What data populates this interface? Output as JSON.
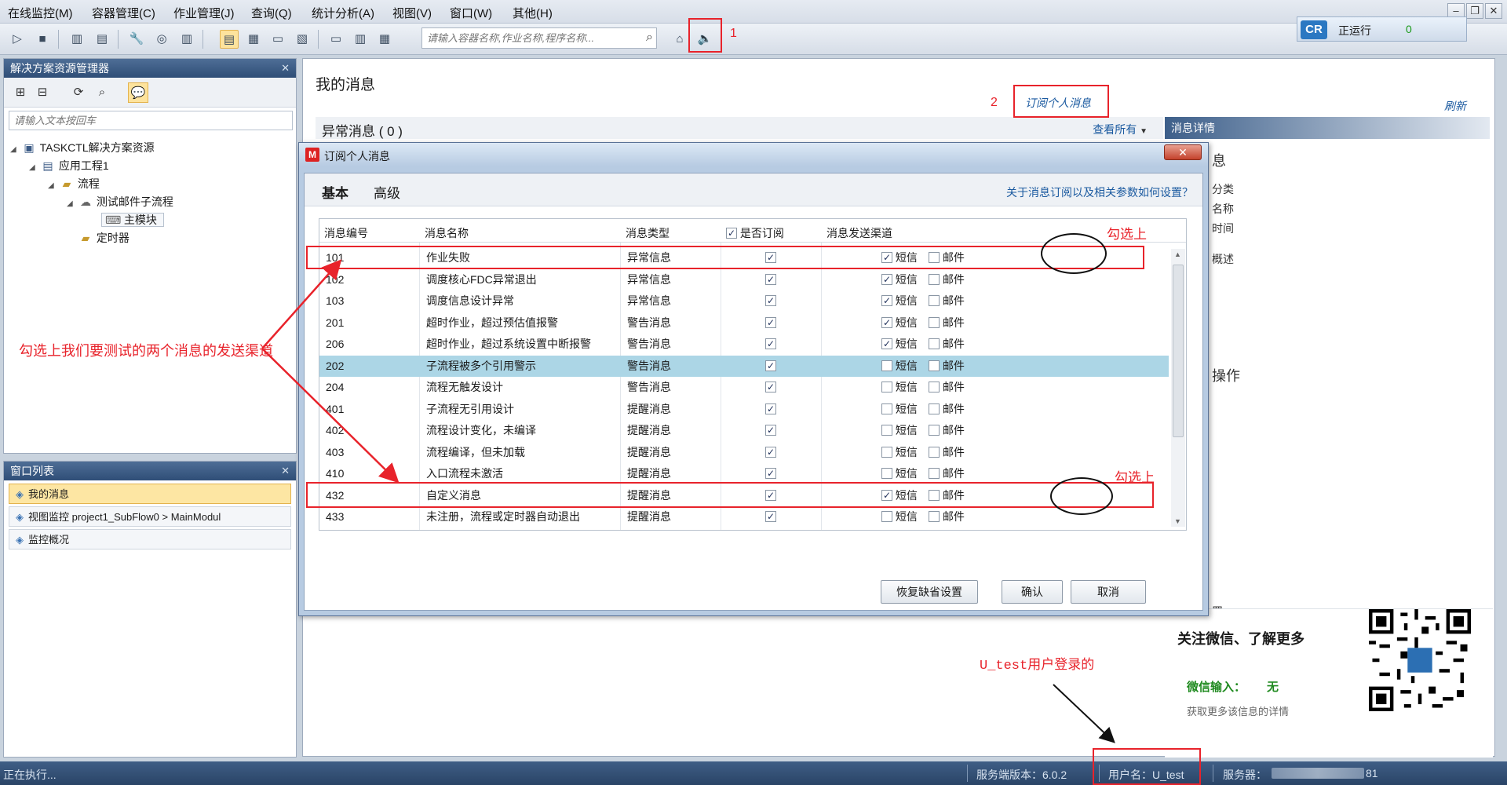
{
  "menu": [
    "在线监控(M)",
    "容器管理(C)",
    "作业管理(J)",
    "查询(Q)",
    "统计分析(A)",
    "视图(V)",
    "窗口(W)",
    "其他(H)"
  ],
  "toolbar": {
    "search_placeholder": "请输入容器名称,作业名称,程序名称..."
  },
  "status_widget": {
    "logo": "CR",
    "label": "正运行",
    "count": "0"
  },
  "explorer": {
    "title": "解决方案资源管理器",
    "search_placeholder": "请输入文本按回车",
    "tree": {
      "root": "TASKCTL解决方案资源",
      "project": "应用工程1",
      "flow": "流程",
      "subflow": "测试邮件子流程",
      "module": "主模块",
      "timer": "定时器"
    }
  },
  "winlist": {
    "title": "窗口列表",
    "items": [
      "我的消息",
      "视图监控  project1_SubFlow0 > MainModul",
      "监控概况"
    ]
  },
  "main": {
    "title": "我的消息",
    "subscribe_link": "订阅个人消息",
    "refresh": "刷新",
    "exception_title": "异常消息 ( 0 )",
    "view_all": "查看所有",
    "detail_title": "消息详情",
    "detail_partial": [
      "息",
      "分类",
      "名称",
      "时间",
      "概述",
      "操作",
      "置"
    ],
    "qr": {
      "title": "关注微信、了解更多",
      "wx_label": "微信输入：",
      "wx_value": "无",
      "more": "获取更多该信息的详情"
    }
  },
  "dialog": {
    "title": "订阅个人消息",
    "close": "✕",
    "tabs": [
      "基本",
      "高级"
    ],
    "help_link": "关于消息订阅以及相关参数如何设置？",
    "columns": [
      "消息编号",
      "消息名称",
      "消息类型",
      "是否订阅",
      "消息发送渠道"
    ],
    "sms_label": "短信",
    "mail_label": "邮件",
    "rows": [
      {
        "id": "101",
        "name": "作业失败",
        "type": "异常信息",
        "sub": true,
        "sms": true,
        "mail": false
      },
      {
        "id": "102",
        "name": "调度核心FDC异常退出",
        "type": "异常信息",
        "sub": true,
        "sms": true,
        "mail": false
      },
      {
        "id": "103",
        "name": "调度信息设计异常",
        "type": "异常信息",
        "sub": true,
        "sms": true,
        "mail": false
      },
      {
        "id": "201",
        "name": "超时作业，超过预估值报警",
        "type": "警告消息",
        "sub": true,
        "sms": true,
        "mail": false
      },
      {
        "id": "206",
        "name": "超时作业，超过系统设置中断报警",
        "type": "警告消息",
        "sub": true,
        "sms": true,
        "mail": false
      },
      {
        "id": "202",
        "name": "子流程被多个引用警示",
        "type": "警告消息",
        "sub": true,
        "sms": false,
        "mail": false
      },
      {
        "id": "204",
        "name": "流程无触发设计",
        "type": "警告消息",
        "sub": true,
        "sms": false,
        "mail": false
      },
      {
        "id": "401",
        "name": "子流程无引用设计",
        "type": "提醒消息",
        "sub": true,
        "sms": false,
        "mail": false
      },
      {
        "id": "402",
        "name": "流程设计变化，未编译",
        "type": "提醒消息",
        "sub": true,
        "sms": false,
        "mail": false
      },
      {
        "id": "403",
        "name": "流程编译，但未加载",
        "type": "提醒消息",
        "sub": true,
        "sms": false,
        "mail": false
      },
      {
        "id": "410",
        "name": "入口流程未激活",
        "type": "提醒消息",
        "sub": true,
        "sms": false,
        "mail": false
      },
      {
        "id": "432",
        "name": "自定义消息",
        "type": "提醒消息",
        "sub": true,
        "sms": true,
        "mail": false
      },
      {
        "id": "433",
        "name": "未注册，流程或定时器自动退出",
        "type": "提醒消息",
        "sub": true,
        "sms": false,
        "mail": false
      }
    ],
    "selected_row": 5,
    "buttons": {
      "restore": "恢复缺省设置",
      "ok": "确认",
      "cancel": "取消"
    }
  },
  "statusbar": {
    "left": "正在执行...",
    "version": "服务端版本：6.0.2",
    "user": "用户名：U_test",
    "server_label": "服务器：",
    "server_tail": "81"
  },
  "annotations": {
    "n1": "1",
    "n2": "2",
    "check1": "勾选上",
    "check2": "勾选上",
    "side_note": "勾选上我们要测试的两个消息的发送渠道",
    "user_note": "U_test用户登录的",
    "color": "#e8232b"
  }
}
